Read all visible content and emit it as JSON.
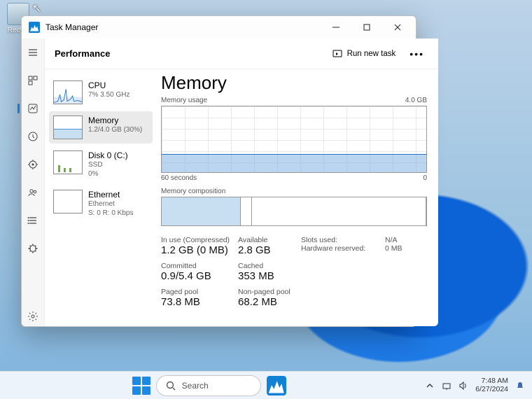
{
  "desktop": {
    "recycle_label": "Recy..."
  },
  "window": {
    "title": "Task Manager",
    "run_task": "Run new task"
  },
  "page_title": "Performance",
  "nav_rail": [
    "menu",
    "processes",
    "performance",
    "history",
    "startup",
    "users",
    "details",
    "services",
    "settings"
  ],
  "cards": [
    {
      "title": "CPU",
      "sub": "7% 3.50 GHz"
    },
    {
      "title": "Memory",
      "sub": "1.2/4.0 GB (30%)"
    },
    {
      "title": "Disk 0 (C:)",
      "sub1": "SSD",
      "sub2": "0%"
    },
    {
      "title": "Ethernet",
      "sub1": "Ethernet",
      "sub2": "S: 0 R: 0 Kbps"
    }
  ],
  "detail": {
    "heading": "Memory",
    "usage_label": "Memory usage",
    "max": "4.0 GB",
    "x_left": "60 seconds",
    "x_right": "0",
    "comp_label": "Memory composition",
    "stats": {
      "inuse_label": "In use (Compressed)",
      "inuse_value": "1.2 GB (0 MB)",
      "avail_label": "Available",
      "avail_value": "2.8 GB",
      "slots_label": "Slots used:",
      "slots_value": "N/A",
      "hw_label": "Hardware reserved:",
      "hw_value": "0 MB",
      "committed_label": "Committed",
      "committed_value": "0.9/5.4 GB",
      "cached_label": "Cached",
      "cached_value": "353 MB",
      "paged_label": "Paged pool",
      "paged_value": "73.8 MB",
      "nonpaged_label": "Non-paged pool",
      "nonpaged_value": "68.2 MB"
    }
  },
  "taskbar": {
    "search_placeholder": "Search",
    "time": "7:48 AM",
    "date": "6/27/2024"
  },
  "chart_data": {
    "type": "line",
    "title": "Memory usage",
    "ylabel": "GB",
    "ylim": [
      0,
      4.0
    ],
    "x_seconds": [
      60,
      55,
      50,
      45,
      40,
      35,
      30,
      25,
      20,
      15,
      10,
      5,
      0
    ],
    "values_gb": [
      1.1,
      1.1,
      1.11,
      1.1,
      1.11,
      1.1,
      1.11,
      1.11,
      1.12,
      1.14,
      1.16,
      1.18,
      1.18
    ],
    "composition": {
      "in_use_gb": 1.2,
      "modified_gb": 0.15,
      "standby_free_gb": 2.65,
      "total_gb": 4.0
    }
  }
}
